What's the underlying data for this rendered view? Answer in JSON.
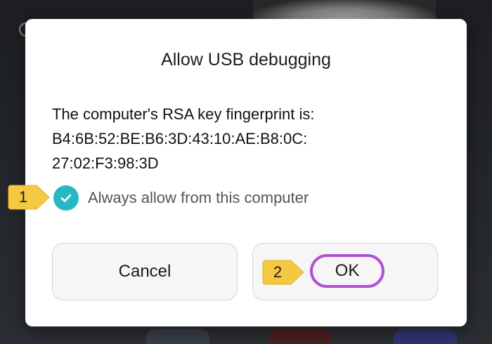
{
  "dialog": {
    "title": "Allow USB debugging",
    "body_line1": "The computer's RSA key fingerprint is:",
    "body_line2": "B4:6B:52:BE:B6:3D:43:10:AE:B8:0C:",
    "body_line3": "27:02:F3:98:3D",
    "checkbox_label": "Always allow from this computer",
    "checkbox_checked": true,
    "cancel_label": "Cancel",
    "ok_label": "OK"
  },
  "callouts": {
    "step1": "1",
    "step2": "2"
  },
  "icons": {
    "checkbox": "check-icon"
  },
  "colors": {
    "checkbox_accent": "#27b8c3",
    "callout_fill": "#f5c842",
    "highlight_ring": "#b14fd6",
    "dialog_bg": "#ffffff"
  }
}
